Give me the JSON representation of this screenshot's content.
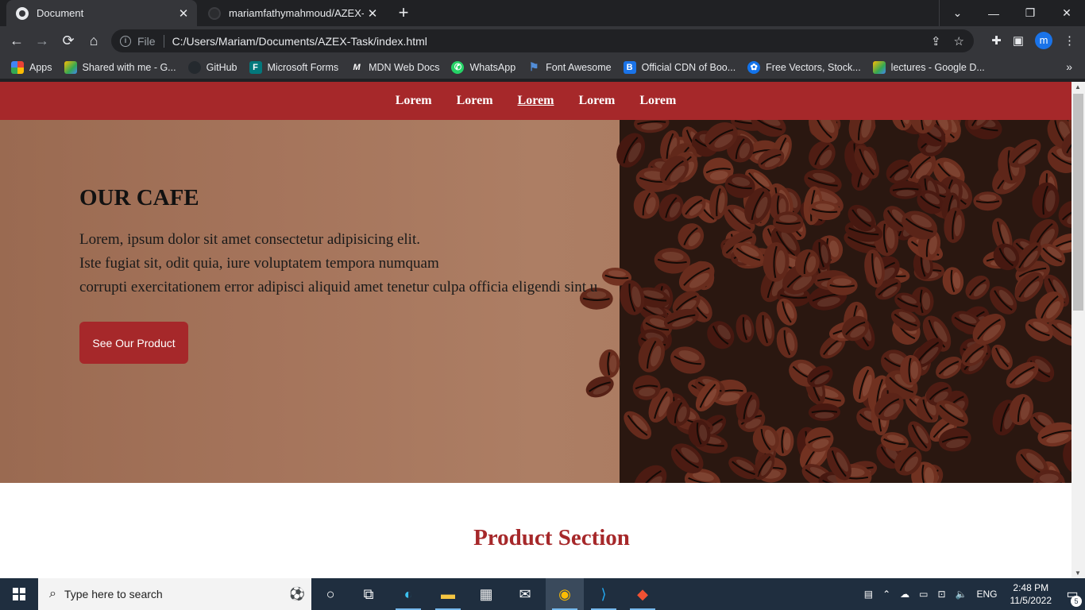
{
  "browser": {
    "tabs": [
      {
        "title": "Document",
        "close": "✕"
      },
      {
        "title": "mariamfathymahmoud/AZEX-Tas",
        "close": "✕"
      }
    ],
    "new_tab": "+",
    "window_controls": [
      "⌄",
      "—",
      "❐",
      "✕"
    ],
    "address": {
      "scheme_label": "File",
      "url": "C:/Users/Mariam/Documents/AZEX-Task/index.html"
    },
    "profile_initial": "m",
    "bookmarks": [
      {
        "label": "Apps",
        "color": "#ea4335"
      },
      {
        "label": "Shared with me - G...",
        "color": "#fbbc04"
      },
      {
        "label": "GitHub",
        "color": "#24292e"
      },
      {
        "label": "Microsoft Forms",
        "color": "#03787c"
      },
      {
        "label": "MDN Web Docs",
        "color": "#000000"
      },
      {
        "label": "WhatsApp",
        "color": "#25d366"
      },
      {
        "label": "Font Awesome",
        "color": "#528dd7"
      },
      {
        "label": "Official CDN of Boo...",
        "color": "#1a73e8"
      },
      {
        "label": "Free Vectors, Stock...",
        "color": "#1273eb"
      },
      {
        "label": "lectures - Google D...",
        "color": "#fbbc04"
      }
    ]
  },
  "page": {
    "nav": [
      "Lorem",
      "Lorem",
      "Lorem",
      "Lorem",
      "Lorem"
    ],
    "nav_active_index": 2,
    "hero": {
      "title": "OUR CAFE",
      "lines": [
        "Lorem, ipsum dolor sit amet consectetur adipisicing elit.",
        "Iste fugiat sit, odit quia, iure voluptatem tempora numquam",
        "corrupti exercitationem error adipisci aliquid amet tenetur culpa officia eligendi sint u"
      ],
      "button": "See Our Product"
    },
    "section_title": "Product Section",
    "accent_color": "#a6282a"
  },
  "taskbar": {
    "search_placeholder": "Type here to search",
    "language": "ENG",
    "time": "2:48 PM",
    "date": "11/5/2022",
    "notification_count": "5"
  }
}
